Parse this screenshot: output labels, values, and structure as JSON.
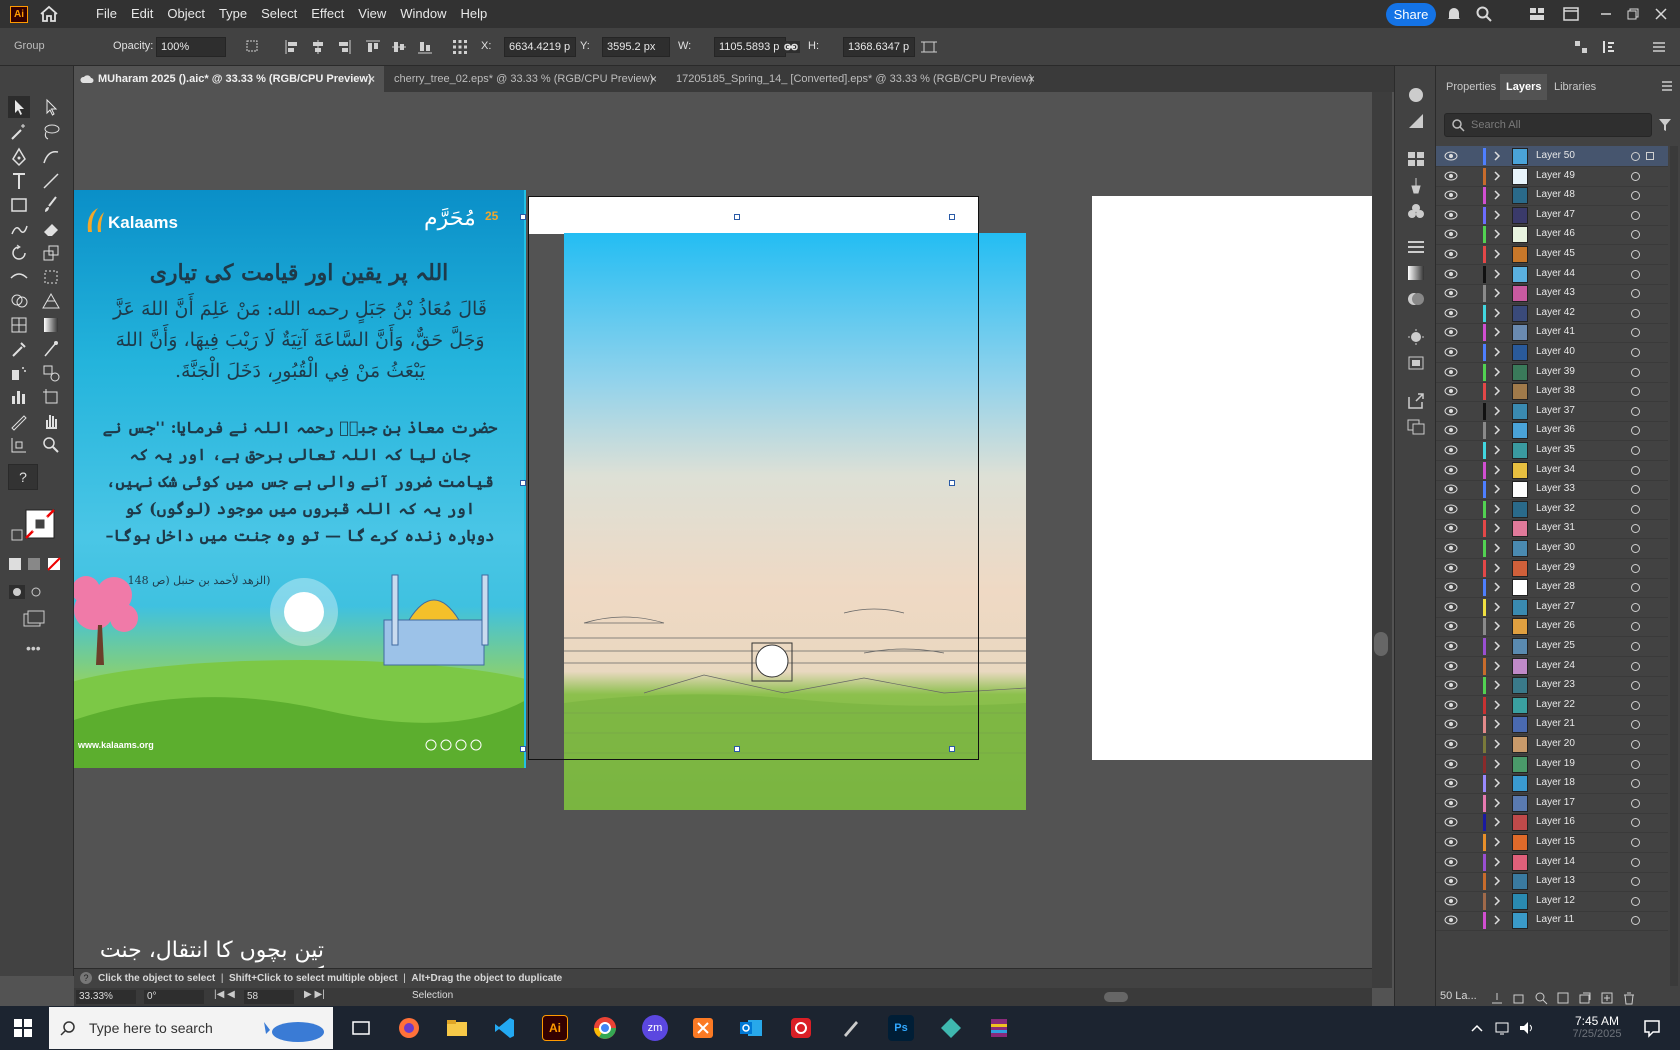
{
  "app": {
    "logo_text": "Ai"
  },
  "menu": [
    "File",
    "Edit",
    "Object",
    "Type",
    "Select",
    "Effect",
    "View",
    "Window",
    "Help"
  ],
  "share_label": "Share",
  "control": {
    "selection_type": "Group",
    "opacity_label": "Opacity:",
    "opacity_value": "100%",
    "x_label": "X:",
    "x_value": "6634.4219 p",
    "y_label": "Y:",
    "y_value": "3595.2 px",
    "w_label": "W:",
    "w_value": "1105.5893 p",
    "h_label": "H:",
    "h_value": "1368.6347 p"
  },
  "tabs": [
    {
      "label": "MUharam 2025 ().aic* @ 33.33 % (RGB/CPU Preview)",
      "active": true
    },
    {
      "label": "cherry_tree_02.eps* @ 33.33 % (RGB/CPU Preview)",
      "active": false
    },
    {
      "label": "17205185_Spring_14_ [Converted].eps* @ 33.33 % (RGB/CPU Preview)",
      "active": false
    }
  ],
  "panel": {
    "tabs": [
      "Properties",
      "Layers",
      "Libraries"
    ],
    "active_tab": "Layers",
    "search_placeholder": "Search All",
    "footer_count": "50 La..."
  },
  "layers": [
    {
      "name": "Layer 50",
      "color": "#4e7fff",
      "selected": true
    },
    {
      "name": "Layer 49",
      "color": "#c86c2c"
    },
    {
      "name": "Layer 48",
      "color": "#d24fd2"
    },
    {
      "name": "Layer 47",
      "color": "#6c6cff"
    },
    {
      "name": "Layer 46",
      "color": "#52d252"
    },
    {
      "name": "Layer 45",
      "color": "#e34848"
    },
    {
      "name": "Layer 44",
      "color": "#111111"
    },
    {
      "name": "Layer 43",
      "color": "#8a8a8a"
    },
    {
      "name": "Layer 42",
      "color": "#42d7e0"
    },
    {
      "name": "Layer 41",
      "color": "#d24fd2"
    },
    {
      "name": "Layer 40",
      "color": "#4e7fff"
    },
    {
      "name": "Layer 39",
      "color": "#52d252"
    },
    {
      "name": "Layer 38",
      "color": "#e34848"
    },
    {
      "name": "Layer 37",
      "color": "#111111"
    },
    {
      "name": "Layer 36",
      "color": "#8a8a8a"
    },
    {
      "name": "Layer 35",
      "color": "#42d7e0"
    },
    {
      "name": "Layer 34",
      "color": "#d24fd2"
    },
    {
      "name": "Layer 33",
      "color": "#4e7fff"
    },
    {
      "name": "Layer 32",
      "color": "#52d252"
    },
    {
      "name": "Layer 31",
      "color": "#e34848"
    },
    {
      "name": "Layer 30",
      "color": "#52d252"
    },
    {
      "name": "Layer 29",
      "color": "#e34848"
    },
    {
      "name": "Layer 28",
      "color": "#4e7fff"
    },
    {
      "name": "Layer 27",
      "color": "#f0e040"
    },
    {
      "name": "Layer 26",
      "color": "#8a8a8a"
    },
    {
      "name": "Layer 25",
      "color": "#9a4fd2"
    },
    {
      "name": "Layer 24",
      "color": "#c86c2c"
    },
    {
      "name": "Layer 23",
      "color": "#52d252"
    },
    {
      "name": "Layer 22",
      "color": "#c83232"
    },
    {
      "name": "Layer 21",
      "color": "#e38a8a"
    },
    {
      "name": "Layer 20",
      "color": "#7a7a3a"
    },
    {
      "name": "Layer 19",
      "color": "#8a2a2a"
    },
    {
      "name": "Layer 18",
      "color": "#9a8aff"
    },
    {
      "name": "Layer 17",
      "color": "#e87ab0"
    },
    {
      "name": "Layer 16",
      "color": "#1a1aa0"
    },
    {
      "name": "Layer 15",
      "color": "#e8902a"
    },
    {
      "name": "Layer 14",
      "color": "#9a4fd2"
    },
    {
      "name": "Layer 13",
      "color": "#c86c2c"
    },
    {
      "name": "Layer 12",
      "color": "#a06a4a"
    },
    {
      "name": "Layer 11",
      "color": "#d24fd2"
    }
  ],
  "poster": {
    "brand": "Kalaams",
    "badge_num": "25",
    "badge_title": "مُحَرَّم",
    "heading": "اللہ پر یقین اور قیامت کی تیاری",
    "arabic": "قَالَ مُعَاذُ بْنُ جَبَلٍ رحمه الله: مَنْ عَلِمَ أَنَّ اللهَ عَزَّ وَجَلَّ حَقٌّ، وَأَنَّ السَّاعَةَ آتِيَةٌ لَا رَيْبَ فِيهَا، وَأَنَّ اللهَ يَبْعَثُ مَنْ فِي الْقُبُورِ، دَخَلَ الْجَنَّةَ.",
    "urdu": "حضرت معاذ بن جبلؒ رحمہ اللہ نے فرمایا: ''جس نے جان لیا کہ اللہ تعالی برحق ہے، اور یہ کہ قیامت ضرور آنے والی ہے جس میں کوئی شک نہیں، اور یہ کہ اللہ قبروں میں موجود (لوگوں) کو دوبارہ زندہ کرے گا — تو وہ جنت میں داخل ہوگا–",
    "reference": "(الزهد لأحمد بن حنبل (ص 148",
    "website": "www.kalaams.org"
  },
  "bottom_text": "تین بچوں کا انتقال، جنت کی",
  "hint": {
    "a": "Click the object to select",
    "b": "Shift+Click to select multiple object",
    "c": "Alt+Drag the object to duplicate"
  },
  "status": {
    "zoom": "33.33%",
    "rotate": "0°",
    "artboard": "58",
    "tool": "Selection"
  },
  "taskbar": {
    "search_placeholder": "Type here to search",
    "time": "7:45 AM",
    "date": "7/25/2025"
  }
}
